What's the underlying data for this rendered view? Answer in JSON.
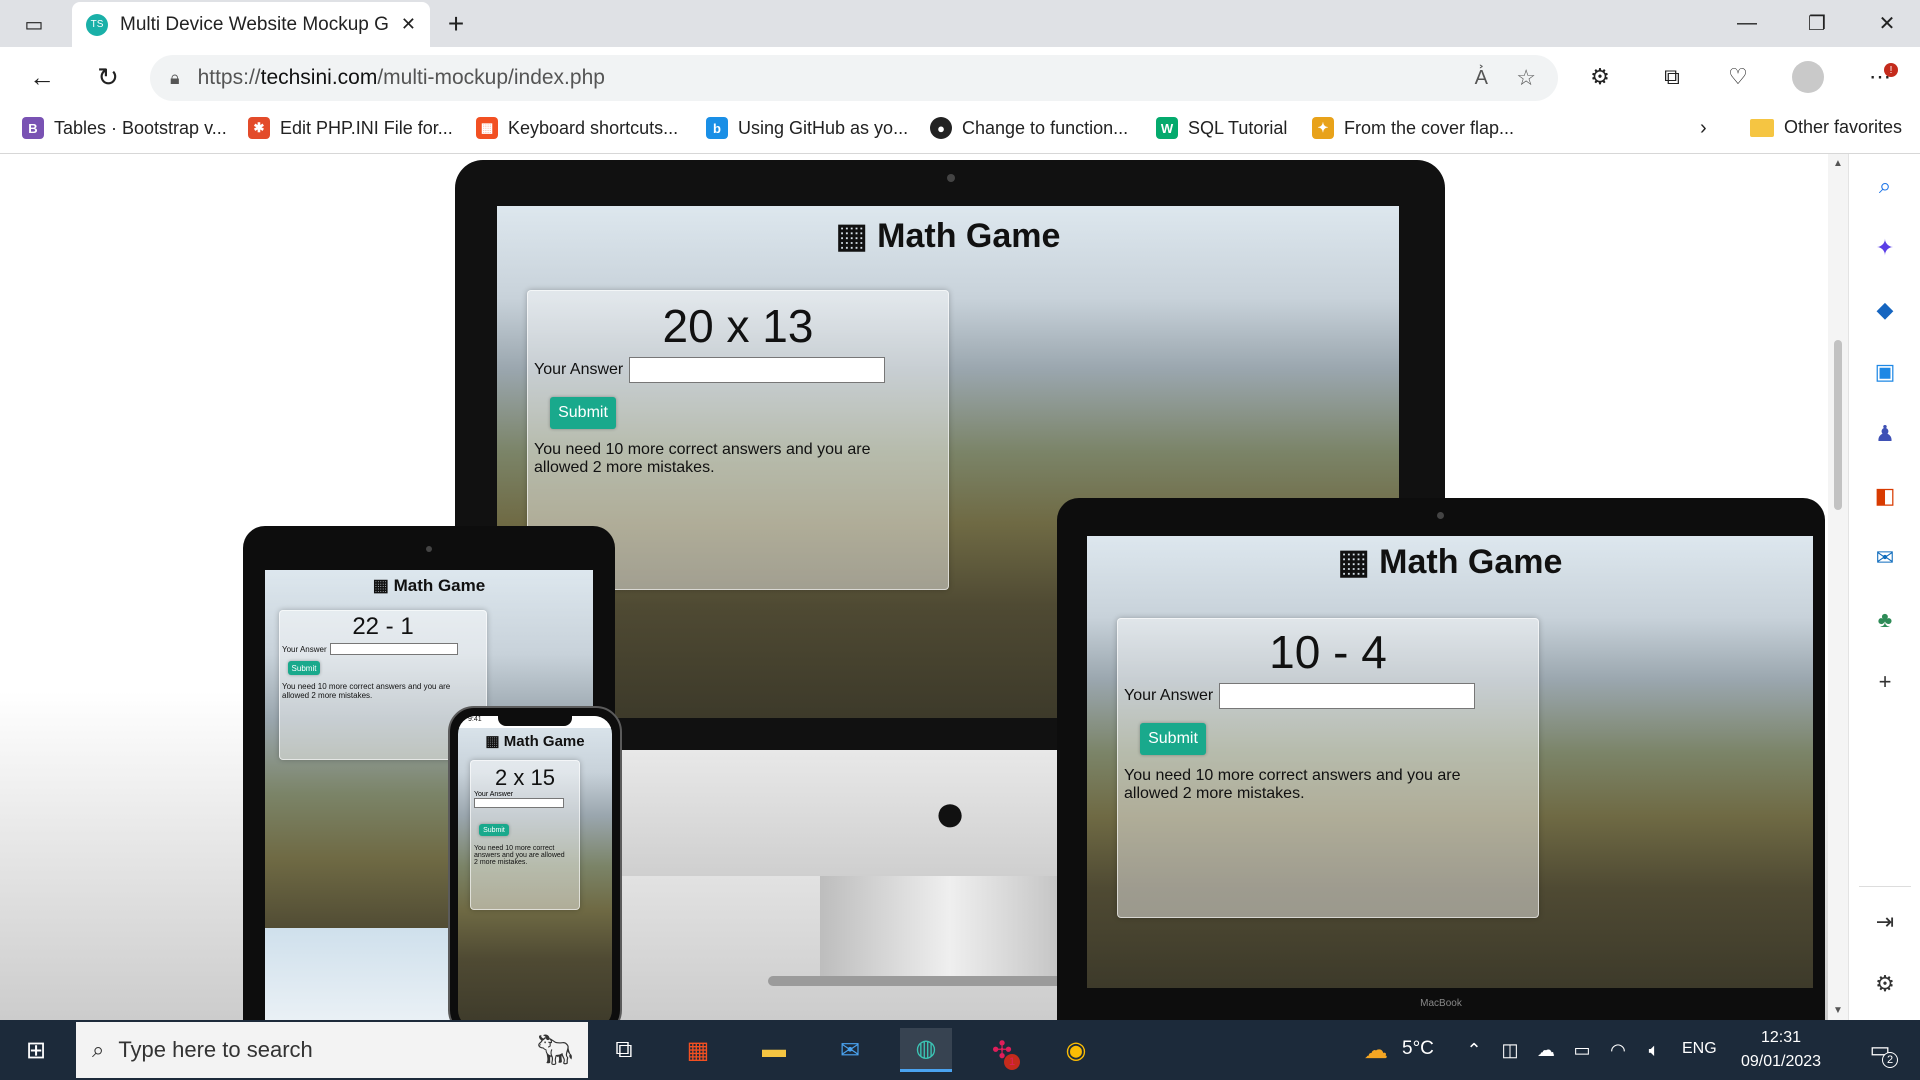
{
  "browser": {
    "tab_title": "Multi Device Website Mockup Ge",
    "favicon_text": "TS",
    "url_prefix": "https://",
    "url_host": "techsini.com",
    "url_path": "/multi-mockup/index.php"
  },
  "bookmarks": {
    "items": [
      {
        "label": "Tables · Bootstrap v...",
        "icon": "bootstrap-icon",
        "color": "#7952b3",
        "glyph": "B"
      },
      {
        "label": "Edit PHP.INI File for...",
        "icon": "joomla-icon",
        "color": "#e34b2a",
        "glyph": "✱"
      },
      {
        "label": "Keyboard shortcuts...",
        "icon": "microsoft-icon",
        "color": "#f25022",
        "glyph": "▦"
      },
      {
        "label": "Using GitHub as yo...",
        "icon": "bing-icon",
        "color": "#1a8fe6",
        "glyph": "b"
      },
      {
        "label": "Change to function...",
        "icon": "github-icon",
        "color": "#222222",
        "glyph": "●"
      },
      {
        "label": "SQL Tutorial",
        "icon": "w3schools-icon",
        "color": "#04aa6d",
        "glyph": "W"
      },
      {
        "label": "From the cover flap...",
        "icon": "bookmark-icon",
        "color": "#e8a21a",
        "glyph": "✦"
      }
    ],
    "other_favorites": "Other favorites"
  },
  "mockups": {
    "imac": {
      "title": "Math Game",
      "question": "20 x 13",
      "answer_label": "Your Answer",
      "submit": "Submit",
      "message": "You need 10 more correct answers and you are allowed 2 more mistakes."
    },
    "macbook": {
      "title": "Math Game",
      "question": "10 - 4",
      "answer_label": "Your Answer",
      "submit": "Submit",
      "message": "You need 10 more correct answers and you are allowed 2 more mistakes.",
      "brand": "MacBook"
    },
    "ipad": {
      "title": "Math Game",
      "question": "22 - 1",
      "answer_label": "Your Answer",
      "submit": "Submit",
      "message": "You need 10 more correct answers and you are allowed 2 more mistakes."
    },
    "iphone": {
      "title": "Math Game",
      "question": "2 x 15",
      "answer_label": "Your Answer",
      "submit": "Submit",
      "message": "You need 10 more correct answers and you are allowed 2 more mistakes.",
      "status_time": "9:41"
    }
  },
  "taskbar": {
    "search_placeholder": "Type here to search",
    "weather": "5°C",
    "language": "ENG",
    "time": "12:31",
    "date": "09/01/2023",
    "notification_count": "2",
    "slack_badge": "1"
  },
  "colors": {
    "accent_submit": "#19a98c",
    "taskbar": "#1c2a3a",
    "tab_strip": "#dfe1e5"
  }
}
